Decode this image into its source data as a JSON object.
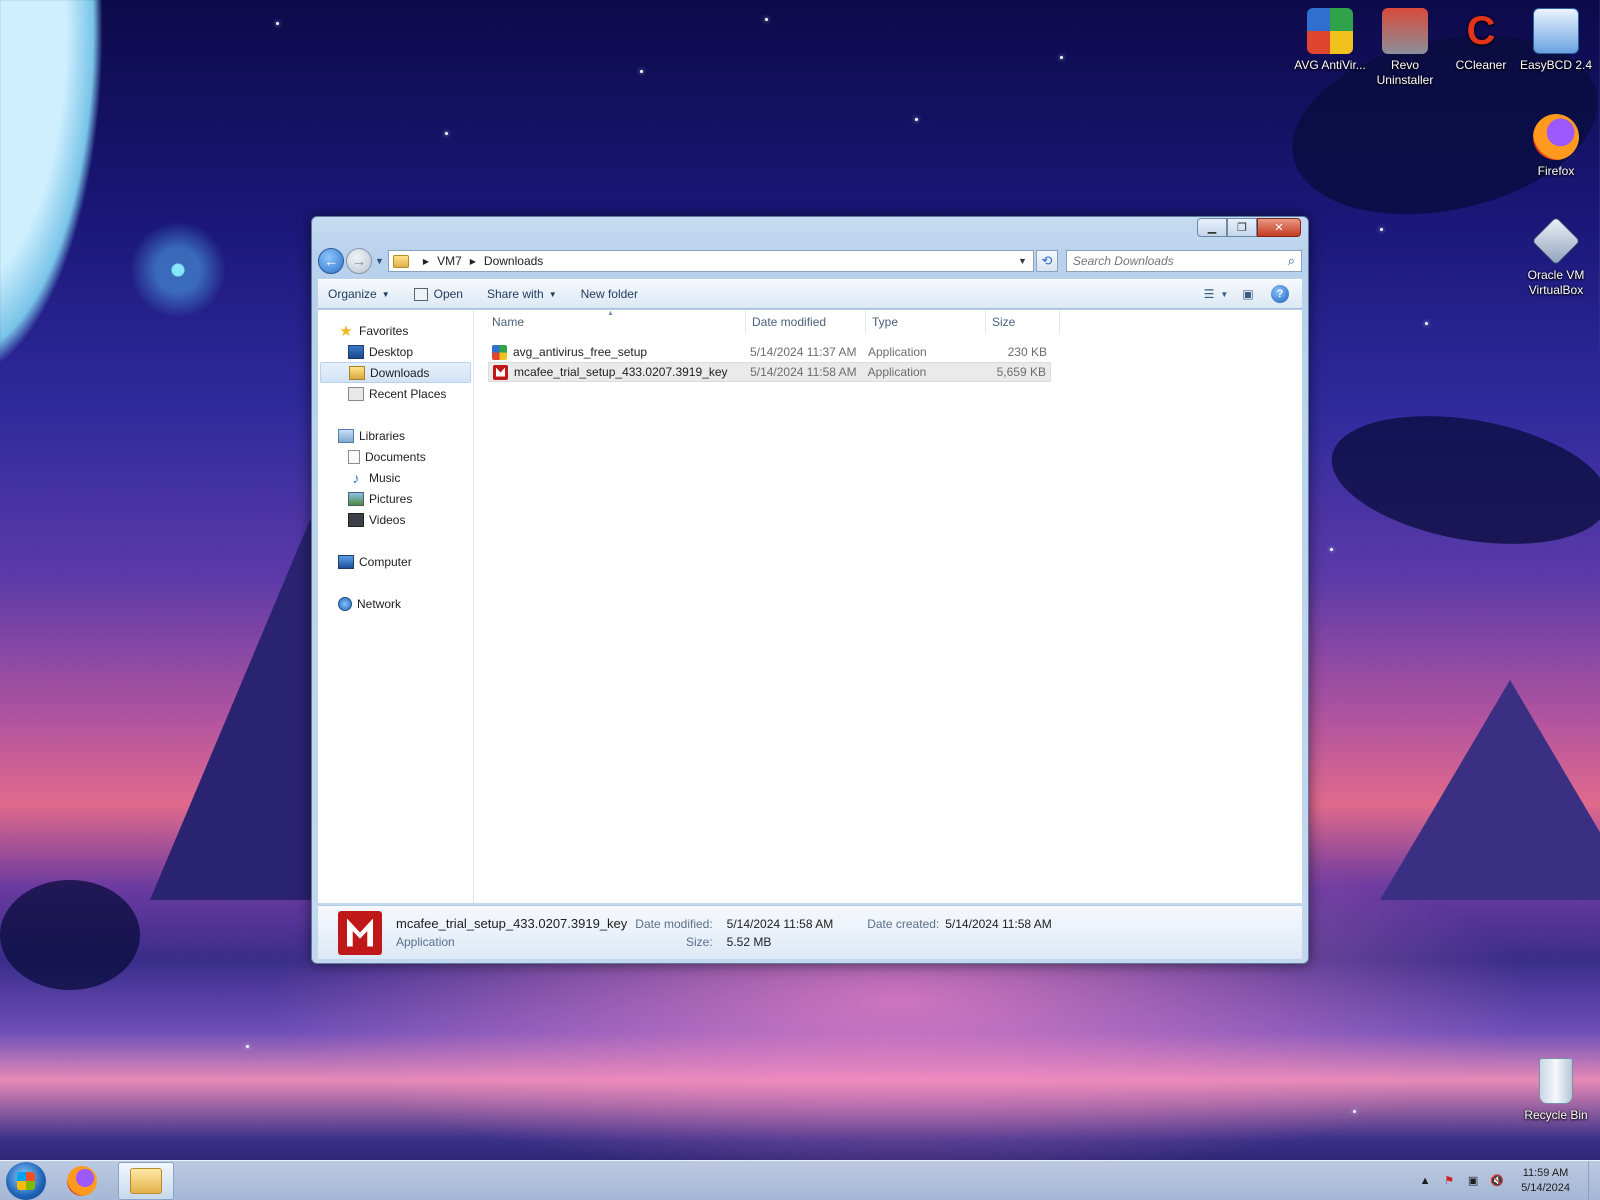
{
  "desktop": {
    "icons": [
      {
        "label": "AVG AntiVir...",
        "icon": "avg-icon"
      },
      {
        "label": "Revo Uninstaller",
        "icon": "revo-icon"
      },
      {
        "label": "CCleaner",
        "icon": "ccleaner-icon"
      },
      {
        "label": "EasyBCD 2.4",
        "icon": "easybcd-icon"
      },
      {
        "label": "Firefox",
        "icon": "firefox-icon"
      },
      {
        "label": "Oracle VM VirtualBox",
        "icon": "virtualbox-icon"
      },
      {
        "label": "Recycle Bin",
        "icon": "recycle-bin-icon"
      }
    ]
  },
  "window": {
    "breadcrumb": [
      "VM7",
      "Downloads"
    ],
    "search_placeholder": "Search Downloads",
    "toolbar": {
      "organize": "Organize",
      "open": "Open",
      "share_with": "Share with",
      "new_folder": "New folder"
    },
    "nav": {
      "favorites": "Favorites",
      "desktop": "Desktop",
      "downloads": "Downloads",
      "recent_places": "Recent Places",
      "libraries": "Libraries",
      "documents": "Documents",
      "music": "Music",
      "pictures": "Pictures",
      "videos": "Videos",
      "computer": "Computer",
      "network": "Network"
    },
    "columns": [
      "Name",
      "Date modified",
      "Type",
      "Size"
    ],
    "files": [
      {
        "name": "avg_antivirus_free_setup",
        "date": "5/14/2024 11:37 AM",
        "type": "Application",
        "size": "230 KB",
        "icon": "avg-icon"
      },
      {
        "name": "mcafee_trial_setup_433.0207.3919_key",
        "date": "5/14/2024 11:58 AM",
        "type": "Application",
        "size": "5,659 KB",
        "icon": "mcafee-icon"
      }
    ],
    "details": {
      "name": "mcafee_trial_setup_433.0207.3919_key",
      "type": "Application",
      "date_modified_label": "Date modified:",
      "date_modified": "5/14/2024 11:58 AM",
      "size_label": "Size:",
      "size": "5.52 MB",
      "date_created_label": "Date created:",
      "date_created": "5/14/2024 11:58 AM"
    }
  },
  "taskbar": {
    "time": "11:59 AM",
    "date": "5/14/2024"
  },
  "colors": {
    "selection": "#d2e3f6",
    "mcafee_red": "#c01818",
    "window_frame": "#c7dcf2"
  }
}
